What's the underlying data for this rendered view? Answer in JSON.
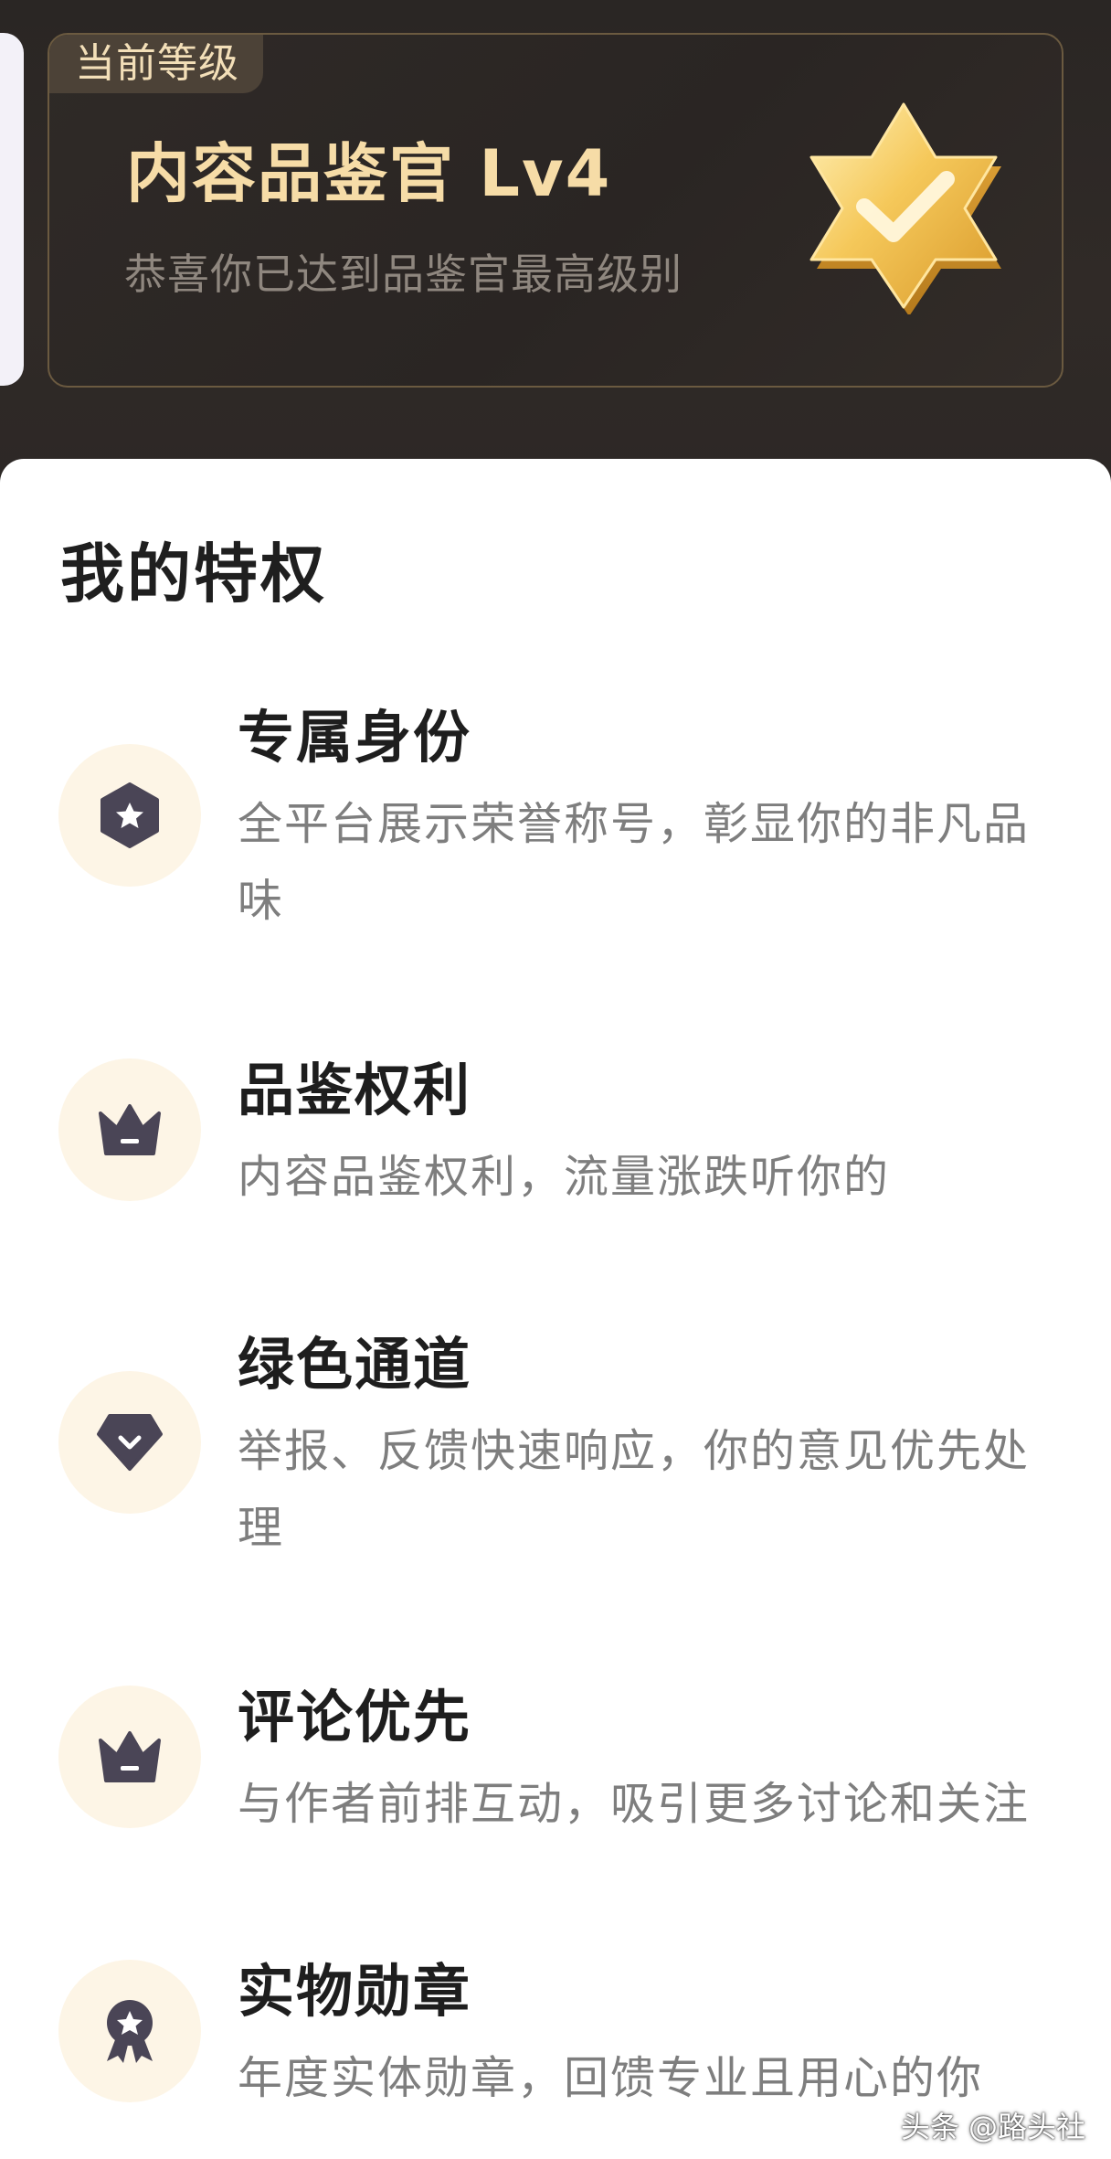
{
  "level_card": {
    "tag": "当前等级",
    "title": "内容品鉴官 Lv4",
    "subtitle": "恭喜你已达到品鉴官最高级别",
    "badge_icon": "gold-star-check-badge-icon"
  },
  "privileges": {
    "section_title": "我的特权",
    "items": [
      {
        "title": "专属身份",
        "desc": "全平台展示荣誉称号，彰显你的非凡品味",
        "icon": "hexagon-star-icon"
      },
      {
        "title": "品鉴权利",
        "desc": "内容品鉴权利，流量涨跌听你的",
        "icon": "crown-icon"
      },
      {
        "title": "绿色通道",
        "desc": "举报、反馈快速响应，你的意见优先处理",
        "icon": "shield-check-icon"
      },
      {
        "title": "评论优先",
        "desc": "与作者前排互动，吸引更多讨论和关注",
        "icon": "crown-icon"
      },
      {
        "title": "实物勋章",
        "desc": "年度实体勋章，回馈专业且用心的你",
        "icon": "medal-star-icon"
      }
    ]
  },
  "watermark": "头条 @路头社",
  "colors": {
    "card_bg": "#2b2624",
    "gold_text": "#f6dca7",
    "icon_bg": "#fdf5e6",
    "icon_fg": "#4a4556"
  }
}
